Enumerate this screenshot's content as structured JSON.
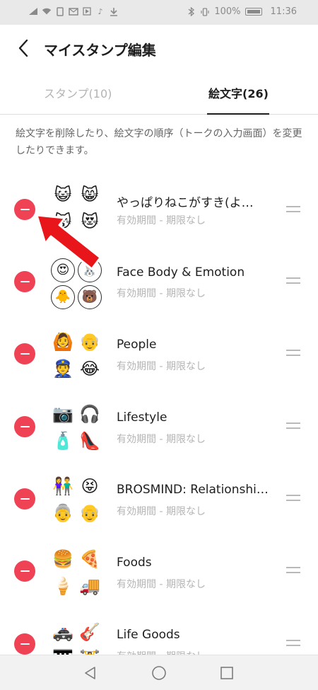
{
  "status_bar": {
    "battery": "100%",
    "time": "11:36"
  },
  "header": {
    "title": "マイスタンプ編集"
  },
  "tabs": {
    "stamps": "スタンプ(10)",
    "emoji": "絵文字(26)"
  },
  "description": "絵文字を削除したり、絵文字の順序（トークの入力画面）を変更したりできます。",
  "items": [
    {
      "name": "やっぱりねこがすき(よ…",
      "sub": "有効期間 - 期限なし",
      "icons": [
        "😺",
        "😸",
        "😽",
        "😻"
      ]
    },
    {
      "name": "Face Body & Emotion",
      "sub": "有効期間 - 期限なし",
      "icons": [
        "😍",
        "🐰",
        "🐥",
        "🐻"
      ]
    },
    {
      "name": "People",
      "sub": "有効期間 - 期限なし",
      "icons": [
        "🙆",
        "👴",
        "👮",
        "😂"
      ]
    },
    {
      "name": "Lifestyle",
      "sub": "有効期間 - 期限なし",
      "icons": [
        "📷",
        "🎧",
        "🧴",
        "👠"
      ]
    },
    {
      "name": "BROSMIND: Relationshi…",
      "sub": "有効期間 - 期限なし",
      "icons": [
        "👫",
        "😝",
        "👵",
        "👴"
      ]
    },
    {
      "name": "Foods",
      "sub": "有効期間 - 期限なし",
      "icons": [
        "🍔",
        "🍕",
        "🍦",
        "🚚"
      ]
    },
    {
      "name": "Life Goods",
      "sub": "有効期間 - 期限なし",
      "icons": [
        "🚓",
        "🎸",
        "🎹",
        "🏋"
      ]
    }
  ],
  "colors": {
    "delete": "#f04255",
    "annotation_arrow": "#e8151b"
  }
}
